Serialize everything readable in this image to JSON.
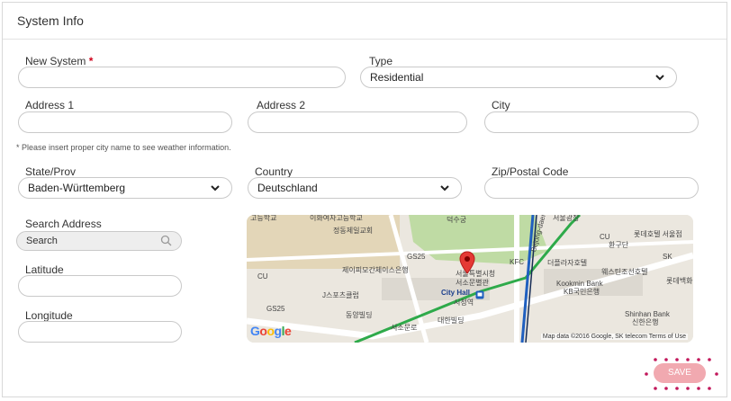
{
  "header": {
    "title": "System Info"
  },
  "form": {
    "new_system": {
      "label": "New System",
      "required_mark": "*",
      "value": ""
    },
    "type": {
      "label": "Type",
      "value": "Residential"
    },
    "address1": {
      "label": "Address 1",
      "value": ""
    },
    "address2": {
      "label": "Address 2",
      "value": ""
    },
    "city": {
      "label": "City",
      "value": ""
    },
    "note": "* Please insert proper city name to see weather information.",
    "state": {
      "label": "State/Prov",
      "value": "Baden-Württemberg"
    },
    "country": {
      "label": "Country",
      "value": "Deutschland"
    },
    "zip": {
      "label": "Zip/Postal Code",
      "value": ""
    },
    "search_address": {
      "label": "Search Address",
      "placeholder": "Search"
    },
    "latitude": {
      "label": "Latitude",
      "value": ""
    },
    "longitude": {
      "label": "Longitude",
      "value": ""
    }
  },
  "map": {
    "labels": {
      "l1": "고등학교",
      "l2": "이화여자고등학교",
      "l3": "정동제일교회",
      "l4": "덕수궁",
      "l5": "서울광장",
      "l6": "CU",
      "l7": "롯데호텔 서울점",
      "l8": "환구단",
      "l9": "SK",
      "l10": "GS25",
      "l11": "CU",
      "l12": "제이피모간체이스은행",
      "l13": "KFC",
      "l14": "더플라자호텔",
      "l15": "웨스틴조선호텔",
      "l16": "롯데백화",
      "l17": "서울특별시청",
      "l18": "서소문별관",
      "l19": "Kookmin Bank",
      "l20": "KB국민은행",
      "l21": "J스포츠클럽",
      "l22": "City Hall",
      "l23": "시청역",
      "l24": "GS25",
      "l25": "동양빌딩",
      "l26": "Shinhan Bank",
      "l27": "신한은행",
      "l28": "대한빌딩",
      "l29": "서소문로",
      "l30": "Sejong-daero"
    },
    "google_logo": "Google",
    "attribution": "Map data ©2016 Google, SK telecom   Terms of Use"
  },
  "actions": {
    "save_label": "SAVE"
  },
  "colors": {
    "required": "#d0021b",
    "save_bg": "#f1a9b0",
    "save_dots": "#c2185b",
    "pin": "#e53935",
    "subway_green": "#2eaa4a",
    "subway_blue": "#1f5fbf"
  },
  "icons": {
    "dropdown": "chevron-down-icon",
    "search": "search-icon",
    "pin": "map-pin-icon",
    "metro": "metro-icon"
  }
}
